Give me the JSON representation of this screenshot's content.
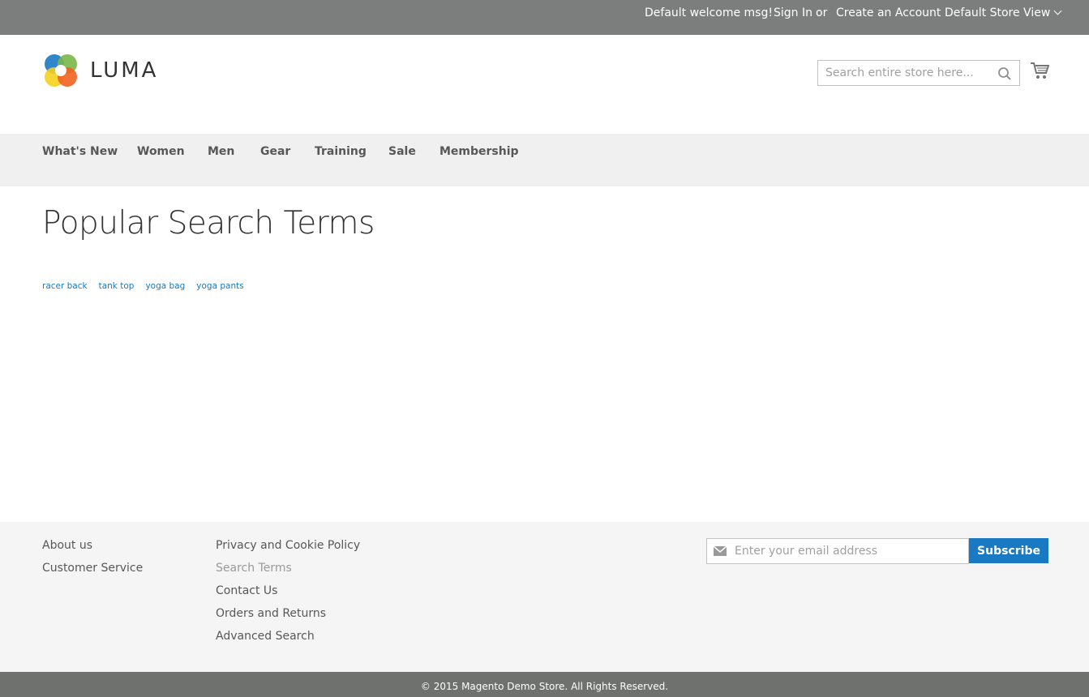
{
  "topbar": {
    "welcome": "Default welcome msg!",
    "sign_in": "Sign In",
    "or": "or",
    "create_account": "Create an Account",
    "store_view": "Default Store View"
  },
  "header": {
    "logo_text": "LUMA",
    "search_placeholder": "Search entire store here..."
  },
  "nav": {
    "items": [
      "What's New",
      "Women",
      "Men",
      "Gear",
      "Training",
      "Sale",
      "Membership"
    ]
  },
  "main": {
    "title": "Popular Search Terms",
    "terms": [
      "racer back",
      "tank top",
      "yoga bag",
      "yoga pants"
    ]
  },
  "footer": {
    "col1": [
      "About us",
      "Customer Service"
    ],
    "col2": [
      "Privacy and Cookie Policy",
      "Search Terms",
      "Contact Us",
      "Orders and Returns",
      "Advanced Search"
    ],
    "newsletter_placeholder": "Enter your email address",
    "subscribe_label": "Subscribe",
    "copyright": "© 2015 Magento Demo Store. All Rights Reserved."
  },
  "colors": {
    "topbar": "#7c7e7d",
    "link": "#1979c3",
    "subscribe": "#1979c3",
    "nav_bg": "#f0f0f0",
    "footer_bg": "#f5f5f5",
    "copyright_bg": "#6e716e"
  }
}
